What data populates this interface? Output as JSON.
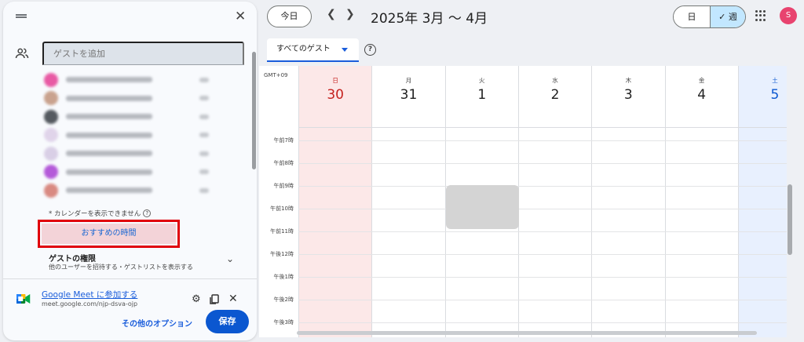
{
  "header": {
    "today_label": "今日",
    "prev_icon": "chevron-left-icon",
    "next_icon": "chevron-right-icon",
    "period_label": "2025年 3月 〜 4月",
    "view_day_label": "日",
    "view_week_label": "週",
    "view_week_check": "✓",
    "avatar_initial": "S",
    "avatar_color": "#e8436f"
  },
  "toolbar": {
    "guest_filter_label": "すべてのゲスト",
    "help_glyph": "?"
  },
  "panel": {
    "add_guest_placeholder": "ゲストを追加",
    "guests": [
      {
        "avatar_color": "#e85aa4"
      },
      {
        "avatar_color": "#c9a28e"
      },
      {
        "avatar_color": "#555a60"
      },
      {
        "avatar_color": "#e0d4ea"
      },
      {
        "avatar_color": "#d9cfe6"
      },
      {
        "avatar_color": "#b45ad9"
      },
      {
        "avatar_color": "#d98a82"
      }
    ],
    "calendar_note": "* カレンダーを表示できません",
    "suggested_time_label": "おすすめの時間",
    "permissions_title": "ゲストの権限",
    "permissions_subtitle": "他のユーザーを招待する・ゲストリストを表示する",
    "meet_link_label": "Google Meet に参加する",
    "meet_url": "meet.google.com/njp-dsva-ojp",
    "more_options_label": "その他のオプション",
    "save_label": "保存",
    "close_glyph": "✕"
  },
  "calendar": {
    "timezone": "GMT+09",
    "days": [
      {
        "dow": "日",
        "date": "30",
        "highlight": "sunday"
      },
      {
        "dow": "月",
        "date": "31"
      },
      {
        "dow": "火",
        "date": "1"
      },
      {
        "dow": "水",
        "date": "2"
      },
      {
        "dow": "木",
        "date": "3"
      },
      {
        "dow": "金",
        "date": "4"
      },
      {
        "dow": "土",
        "date": "5",
        "highlight": "saturday"
      }
    ],
    "hours": [
      "午前7時",
      "午前8時",
      "午前9時",
      "午前10時",
      "午前11時",
      "午後12時",
      "午後1時",
      "午後2時",
      "午後3時"
    ],
    "sunday_color": "#c5221f",
    "saturday_color": "#0b57d0",
    "sunday_bg": "#fce8e8",
    "saturday_bg": "#e8f0fe"
  }
}
